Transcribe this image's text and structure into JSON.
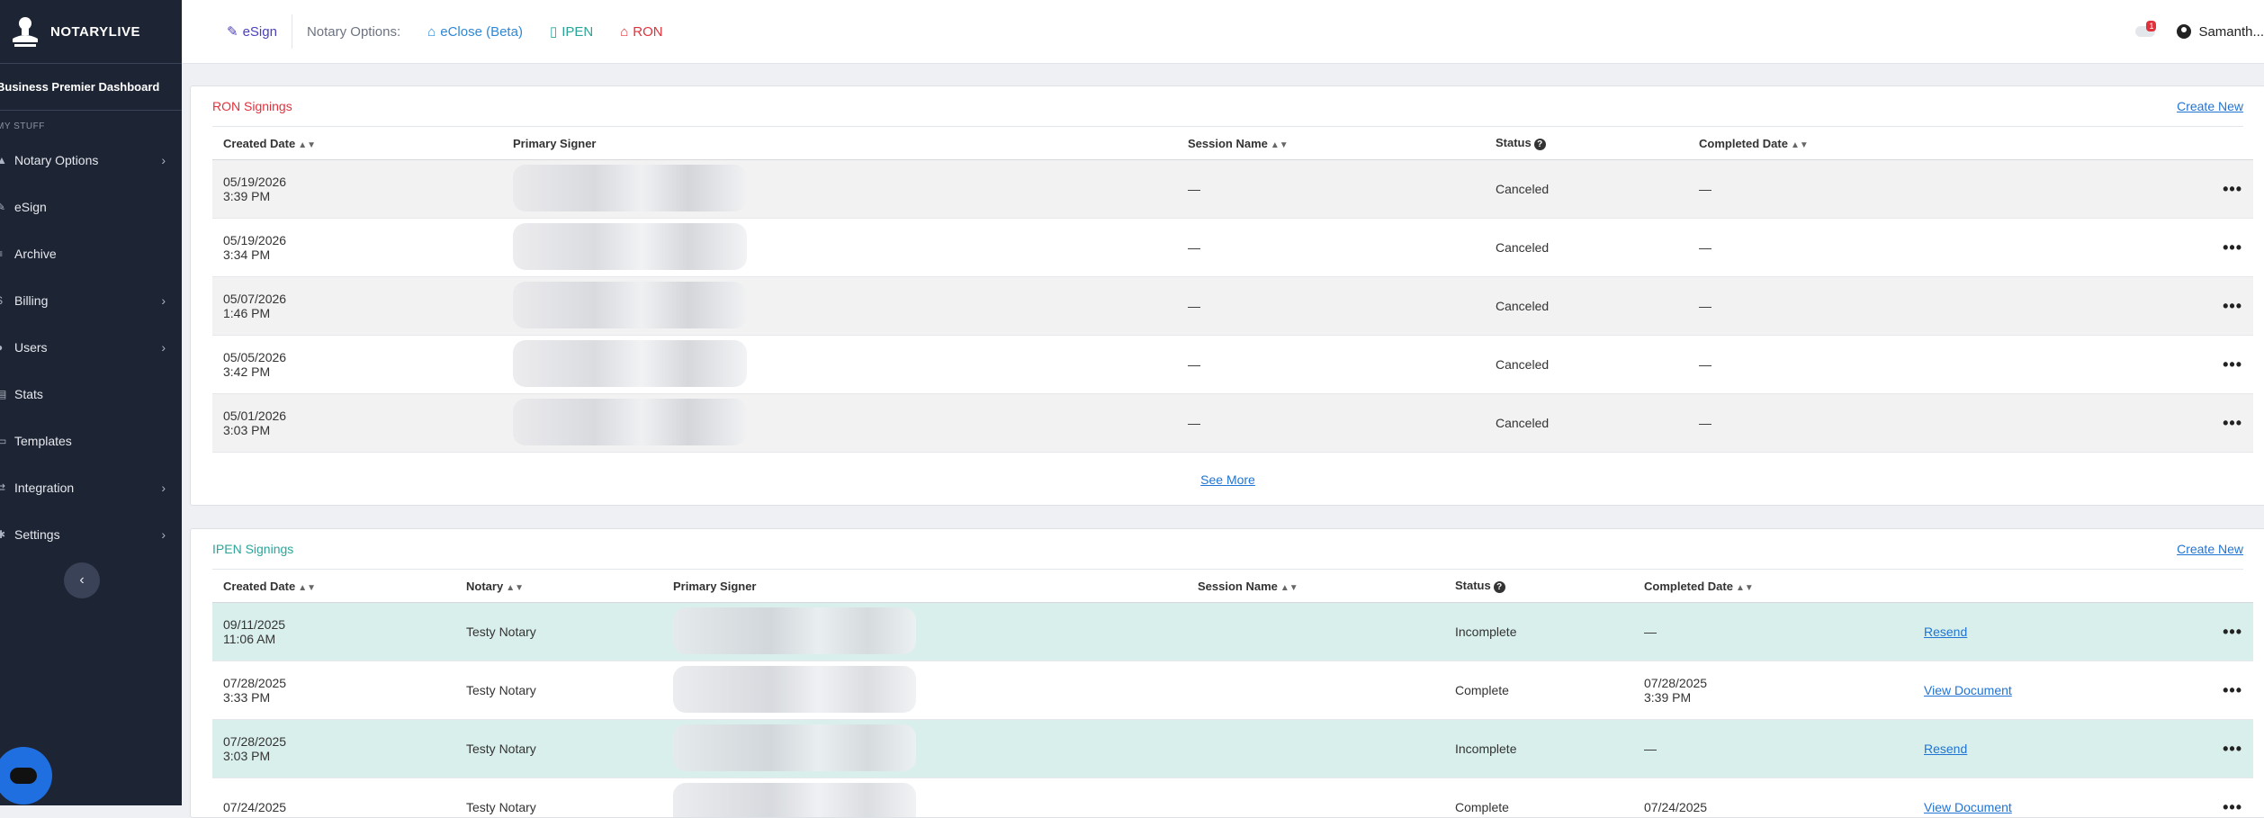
{
  "brand": {
    "name": "NOTARYLIVE"
  },
  "sidebar": {
    "dashboard_title": "Business Premier Dashboard",
    "section_label": "MY STUFF",
    "items": [
      {
        "label": "Notary Options",
        "icon": "stamp-icon",
        "has_submenu": true
      },
      {
        "label": "eSign",
        "icon": "pen-icon",
        "has_submenu": false
      },
      {
        "label": "Archive",
        "icon": "list-icon",
        "has_submenu": false
      },
      {
        "label": "Billing",
        "icon": "dollar-icon",
        "has_submenu": true
      },
      {
        "label": "Users",
        "icon": "users-icon",
        "has_submenu": true
      },
      {
        "label": "Stats",
        "icon": "chart-icon",
        "has_submenu": false
      },
      {
        "label": "Templates",
        "icon": "file-icon",
        "has_submenu": false
      },
      {
        "label": "Integration",
        "icon": "plug-icon",
        "has_submenu": true
      },
      {
        "label": "Settings",
        "icon": "gear-icon",
        "has_submenu": true
      }
    ],
    "collapse_glyph": "‹"
  },
  "topbar": {
    "esign": "eSign",
    "notary_options_label": "Notary Options:",
    "eclose": "eClose (Beta)",
    "ipen": "IPEN",
    "ron": "RON",
    "notification_count": "1",
    "user_name": "Samanth..."
  },
  "ron": {
    "title": "RON Signings",
    "create_new": "Create New",
    "headers": {
      "created": "Created Date",
      "primary_signer": "Primary Signer",
      "session": "Session Name",
      "status": "Status",
      "completed": "Completed Date"
    },
    "rows": [
      {
        "date": "05/19/2026",
        "time": "3:39 PM",
        "session": "—",
        "status": "Canceled",
        "completed": "—"
      },
      {
        "date": "05/19/2026",
        "time": "3:34 PM",
        "session": "—",
        "status": "Canceled",
        "completed": "—"
      },
      {
        "date": "05/07/2026",
        "time": "1:46 PM",
        "session": "—",
        "status": "Canceled",
        "completed": "—"
      },
      {
        "date": "05/05/2026",
        "time": "3:42 PM",
        "session": "—",
        "status": "Canceled",
        "completed": "—"
      },
      {
        "date": "05/01/2026",
        "time": "3:03 PM",
        "session": "—",
        "status": "Canceled",
        "completed": "—"
      }
    ],
    "see_more": "See More"
  },
  "ipen": {
    "title": "IPEN Signings",
    "create_new": "Create New",
    "headers": {
      "created": "Created Date",
      "notary": "Notary",
      "primary_signer": "Primary Signer",
      "session": "Session Name",
      "status": "Status",
      "completed": "Completed Date"
    },
    "rows": [
      {
        "date": "09/11/2025",
        "time": "11:06 AM",
        "notary": "Testy Notary",
        "status": "Incomplete",
        "completed_date": "—",
        "completed_time": "",
        "action": "Resend",
        "highlight": true
      },
      {
        "date": "07/28/2025",
        "time": "3:33 PM",
        "notary": "Testy Notary",
        "status": "Complete",
        "completed_date": "07/28/2025",
        "completed_time": "3:39 PM",
        "action": "View Document",
        "highlight": false
      },
      {
        "date": "07/28/2025",
        "time": "3:03 PM",
        "notary": "Testy Notary",
        "status": "Incomplete",
        "completed_date": "—",
        "completed_time": "",
        "action": "Resend",
        "highlight": true
      },
      {
        "date": "07/24/2025",
        "time": "",
        "notary": "Testy Notary",
        "status": "Complete",
        "completed_date": "07/24/2025",
        "completed_time": "",
        "action": "View Document",
        "highlight": false
      }
    ]
  },
  "colors": {
    "sidebar_bg": "#1d2433",
    "ron_accent": "#e0323c",
    "ipen_accent": "#2aa59a",
    "link": "#1f74d4",
    "esign_accent": "#4a3fbf"
  }
}
